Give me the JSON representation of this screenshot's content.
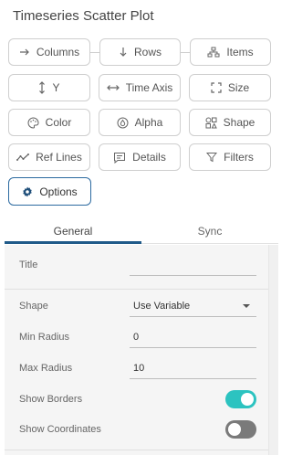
{
  "panel_title": "Timeseries Scatter Plot",
  "buttons": {
    "columns": "Columns",
    "rows": "Rows",
    "items": "Items",
    "y": "Y",
    "time_axis": "Time Axis",
    "size": "Size",
    "color": "Color",
    "alpha": "Alpha",
    "shape": "Shape",
    "ref_lines": "Ref Lines",
    "details": "Details",
    "filters": "Filters",
    "options": "Options"
  },
  "tabs": {
    "general": "General",
    "sync": "Sync",
    "active": "General"
  },
  "settings": {
    "title_label": "Title",
    "title_value": "",
    "shape_label": "Shape",
    "shape_value": "Use Variable",
    "min_radius_label": "Min Radius",
    "min_radius_value": "0",
    "max_radius_label": "Max Radius",
    "max_radius_value": "10",
    "show_borders_label": "Show Borders",
    "show_borders_on": true,
    "show_coordinates_label": "Show Coordinates",
    "show_coordinates_on": false
  },
  "colors": {
    "accent": "#1f5a89",
    "toggle_on": "#2cc3c0",
    "toggle_off": "#7a7a7a"
  }
}
